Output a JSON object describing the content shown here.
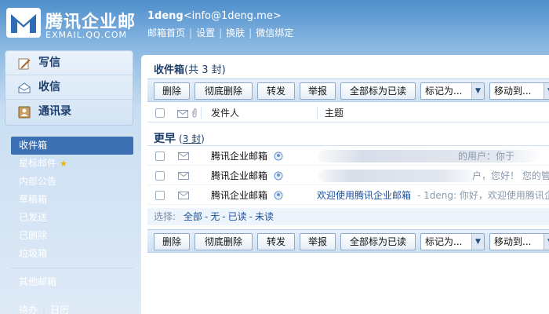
{
  "header": {
    "logo_name": "腾讯企业邮",
    "logo_domain": "EXMAIL.QQ.COM",
    "user_name": "1deng",
    "user_email": "<info@1deng.me>",
    "links": [
      "邮箱首页",
      "设置",
      "换肤",
      "微信绑定"
    ]
  },
  "sidebar": {
    "main_items": [
      {
        "label": "写信",
        "icon": "pencil-icon"
      },
      {
        "label": "收信",
        "icon": "inbox-icon"
      },
      {
        "label": "通讯录",
        "icon": "contacts-icon"
      }
    ],
    "folders": [
      "收件箱",
      "星标邮件",
      "内部公告",
      "草稿箱",
      "已发送",
      "已删除",
      "垃圾箱"
    ],
    "other_folder": "其他邮箱",
    "bottom_links": [
      "待办",
      "日历"
    ]
  },
  "main": {
    "title": "收件箱",
    "title_count": "(共 3 封)",
    "toolbar": {
      "delete": "删除",
      "perm_delete": "彻底删除",
      "forward": "转发",
      "report": "举报",
      "mark_all_read": "全部标为已读",
      "mark_as": "标记为...",
      "move_to": "移动到..."
    },
    "columns": {
      "sender": "发件人",
      "subject": "主题"
    },
    "group": {
      "label": "更早",
      "count": "3 封"
    },
    "rows": [
      {
        "sender": "腾讯企业邮箱",
        "subject": "",
        "preview": "的用户：你于"
      },
      {
        "sender": "腾讯企业邮箱",
        "subject": "",
        "preview": "户，您好！ 您的管理员"
      },
      {
        "sender": "腾讯企业邮箱",
        "subject": "欢迎使用腾讯企业邮箱",
        "preview": "- 1deng: 你好，欢迎使用腾讯企"
      }
    ],
    "select_line": {
      "label": "选择:",
      "options": [
        "全部",
        "无",
        "已读",
        "未读"
      ]
    }
  },
  "colors": {
    "accent": "#3d6fb3",
    "header_blue": "#4f8fcc",
    "link": "#1b4f9c"
  }
}
